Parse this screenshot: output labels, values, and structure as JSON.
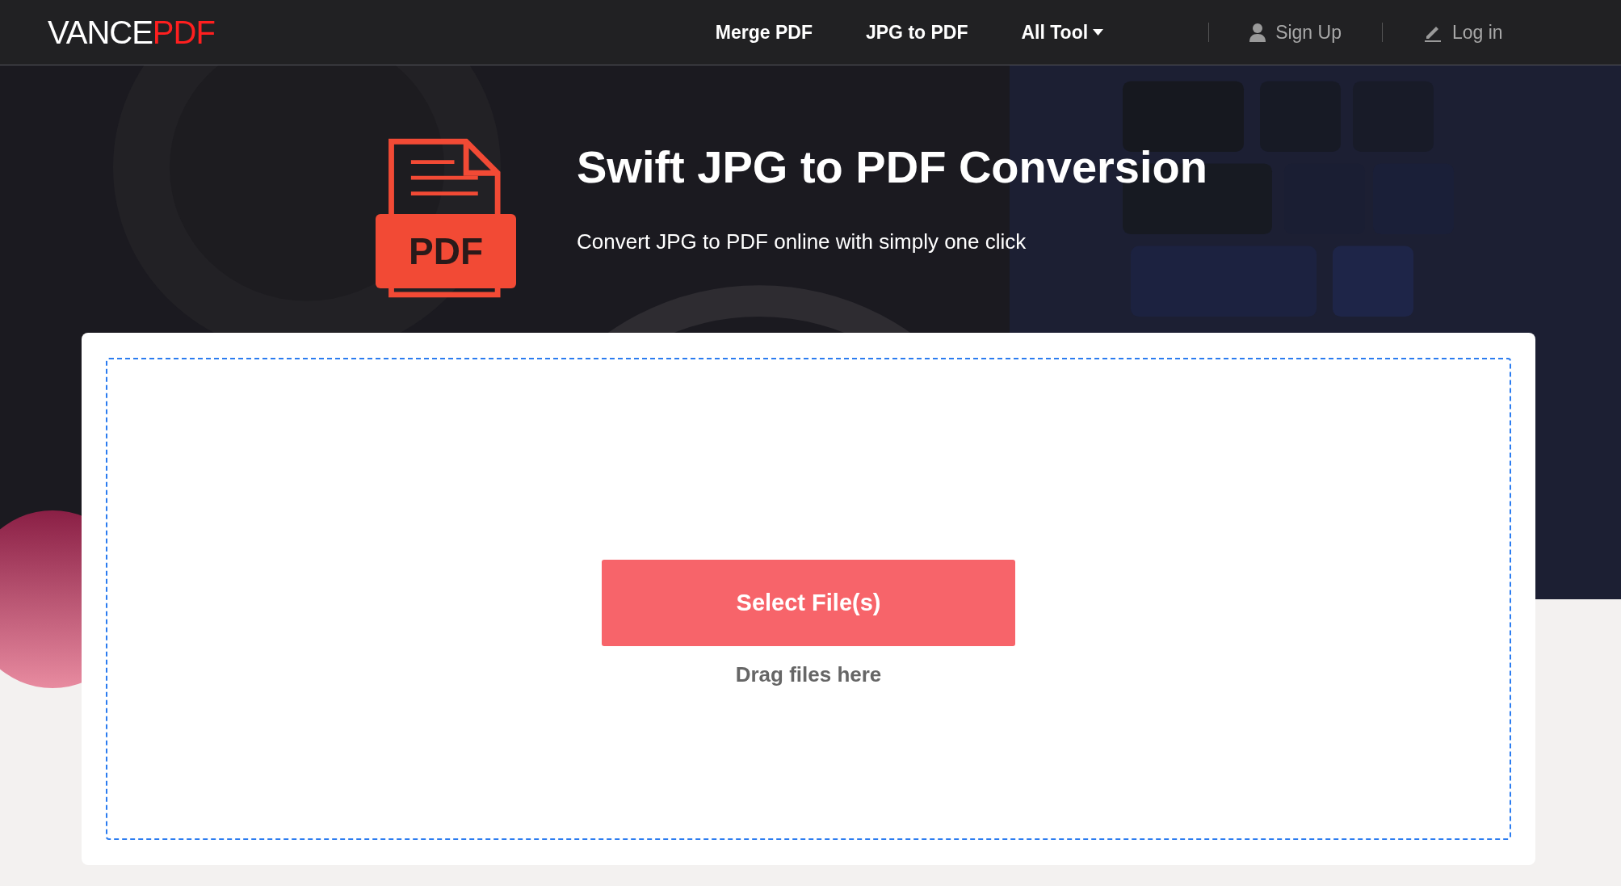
{
  "header": {
    "logo": {
      "main": "VANCE",
      "accent": "PDF"
    },
    "nav": [
      {
        "label": "Merge PDF",
        "kind": "link"
      },
      {
        "label": "JPG to PDF",
        "kind": "link"
      },
      {
        "label": "All Tool",
        "kind": "dropdown"
      }
    ],
    "account": [
      {
        "label": "Sign Up",
        "kind": "user"
      },
      {
        "label": "Log in",
        "kind": "pencil"
      }
    ]
  },
  "hero": {
    "icon_label": "PDF",
    "title": "Swift JPG to PDF Conversion",
    "subtitle": "Convert JPG to PDF online with simply one click"
  },
  "upload": {
    "button": "Select File(s)",
    "hint": "Drag files here"
  }
}
